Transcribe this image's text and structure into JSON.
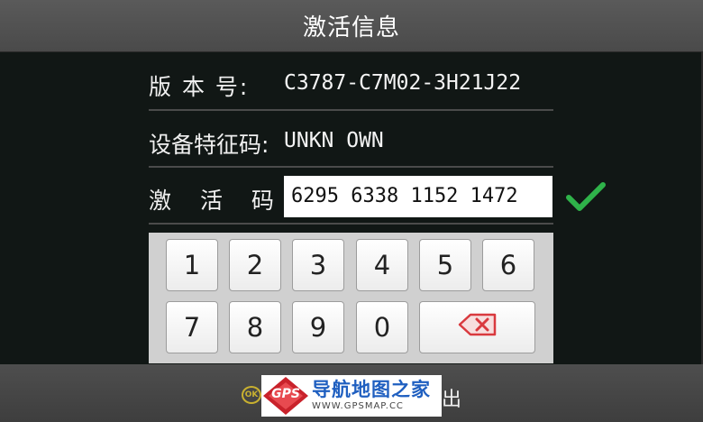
{
  "header": {
    "title": "激活信息"
  },
  "rows": {
    "version": {
      "label": "版 本 号:",
      "value": "C3787-C7M02-3H21J22"
    },
    "device": {
      "label": "设备特征码:",
      "value": "UNKN OWN"
    },
    "activation": {
      "label": "激 活 码:",
      "value": "6295 6338 1152 1472"
    }
  },
  "keypad": {
    "keys": [
      "1",
      "2",
      "3",
      "4",
      "5",
      "6",
      "7",
      "8",
      "9",
      "0"
    ],
    "backspace_icon": "backspace-icon"
  },
  "status": {
    "check_icon": "checkmark-icon",
    "check_color": "#2fb34a"
  },
  "footer": {
    "ok_glyph": "OK",
    "exit_visible_tail": "出"
  },
  "watermark": {
    "logo_text": "GPS",
    "title": "导航地图之家",
    "url": "WWW.GPSMAP.CC"
  }
}
